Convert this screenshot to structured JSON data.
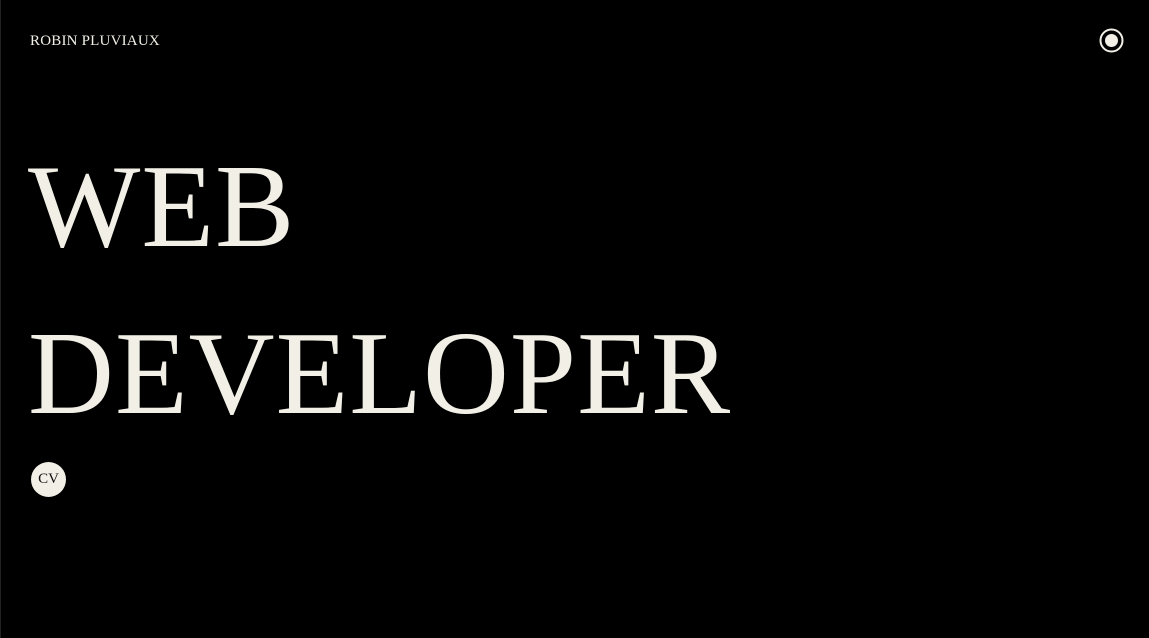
{
  "header": {
    "brand": "ROBIN PLUVIAUX",
    "theme_toggle_icon": "radio-toggle-icon"
  },
  "hero": {
    "line1": "WEB",
    "line2": "DEVELOPER"
  },
  "cv_button": {
    "label": "CV"
  },
  "colors": {
    "background": "#000000",
    "foreground": "#f2f0e6"
  }
}
